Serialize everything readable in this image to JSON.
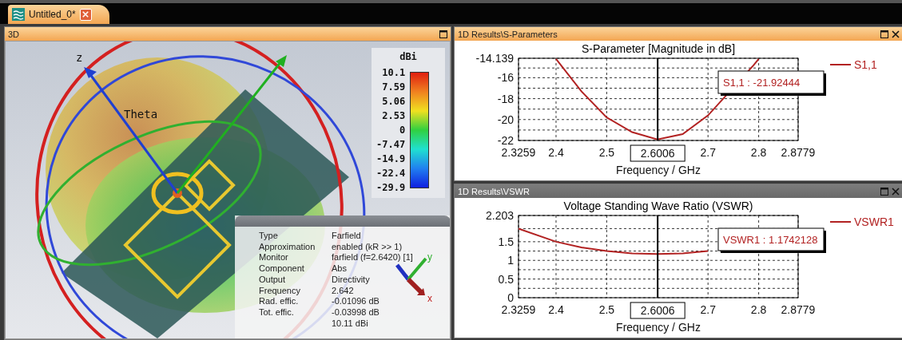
{
  "tabs": [
    {
      "label": "Untitled_0*",
      "selected": true
    }
  ],
  "view_3d": {
    "title": "3D",
    "active": true,
    "closable": false,
    "axis_label": "z",
    "angle_label": "Theta",
    "legend": {
      "unit": "dBi",
      "ticks": [
        "10.1",
        "7.59",
        "5.06",
        "2.53",
        "0",
        "-7.47",
        "-14.9",
        "-22.4",
        "-29.9"
      ]
    },
    "info": [
      {
        "label": "Type",
        "value": "Farfield"
      },
      {
        "label": "Approximation",
        "value": "enabled (kR >> 1)"
      },
      {
        "label": "Monitor",
        "value": "farfield (f=2.6420) [1]"
      },
      {
        "label": "Component",
        "value": "Abs"
      },
      {
        "label": "Output",
        "value": "Directivity"
      },
      {
        "label": "Frequency",
        "value": "2.642"
      },
      {
        "label": "Rad. effic.",
        "value": "-0.01096 dB"
      },
      {
        "label": "Tot. effic.",
        "value": "-0.03998 dB"
      },
      {
        "value": "10.11 dBi"
      }
    ],
    "triad_labels": [
      "y",
      "x"
    ]
  },
  "panels": [
    {
      "title": "1D Results\\S-Parameters",
      "active": true,
      "closable": true,
      "chart_data": {
        "type": "line",
        "grid": true,
        "ref_lines": [
          {
            "axis": "x",
            "value": 2.6006,
            "label": "2.6006"
          }
        ],
        "annotations": [
          {
            "text": "S1,1 : -21.92444"
          }
        ],
        "title": "S-Parameter [Magnitude in dB]",
        "xlabel": "Frequency / GHz",
        "xlim": [
          2.3259,
          2.8779
        ],
        "ylim": [
          -22,
          -14.139
        ],
        "xticks": [
          2.3259,
          2.4,
          2.5,
          2.7,
          2.8,
          2.8779
        ],
        "yticks": [
          {
            "value": -14.139,
            "label": "-14.139"
          },
          -16,
          -18,
          -20,
          -22
        ],
        "x": [
          2.4,
          2.45,
          2.5,
          2.55,
          2.6,
          2.65,
          2.7,
          2.79,
          2.8
        ],
        "series": [
          {
            "name": "S1,1",
            "color": "#b22222",
            "values": [
              -14.2,
              -17.3,
              -19.8,
              -21.2,
              -21.9,
              -21.4,
              -19.6,
              -14.8,
              -14.2
            ]
          }
        ]
      }
    },
    {
      "title": "1D Results\\VSWR",
      "active": false,
      "closable": true,
      "chart_data": {
        "type": "line",
        "grid": true,
        "ref_lines": [
          {
            "axis": "x",
            "value": 2.6006,
            "label": "2.6006"
          }
        ],
        "annotations": [
          {
            "text": "VSWR1 : 1.1742128"
          }
        ],
        "title": "Voltage Standing Wave Ratio (VSWR)",
        "xlabel": "Frequency / GHz",
        "xlim": [
          2.3259,
          2.8779
        ],
        "ylim": [
          0,
          2.203
        ],
        "xticks": [
          2.3259,
          2.4,
          2.5,
          2.7,
          2.8,
          2.8779
        ],
        "yticks": [
          0,
          0.5,
          1,
          1.5,
          {
            "value": 2.203,
            "label": "2.203"
          }
        ],
        "x": [
          2.3259,
          2.4,
          2.45,
          2.5,
          2.55,
          2.6,
          2.65,
          2.7
        ],
        "series": [
          {
            "name": "VSWR1",
            "color": "#b22222",
            "values": [
              1.85,
              1.5,
              1.35,
              1.25,
              1.19,
              1.17,
              1.19,
              1.25
            ]
          }
        ]
      }
    }
  ]
}
